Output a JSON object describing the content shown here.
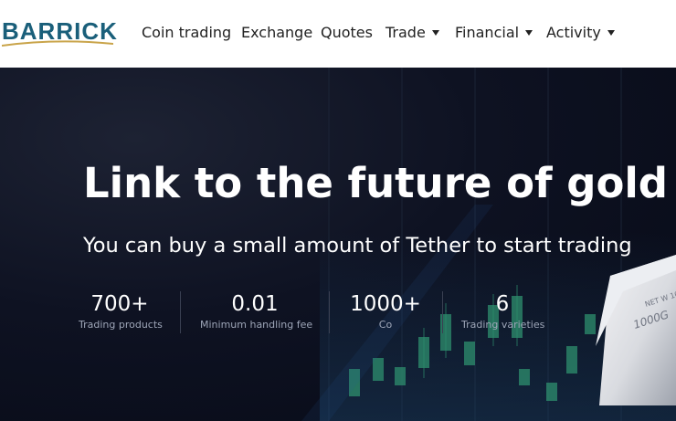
{
  "header": {
    "logo_text": "BARRICK",
    "nav": [
      {
        "label": "Coin trading"
      },
      {
        "label": "Exchange"
      },
      {
        "label": "Quotes"
      },
      {
        "label": "Trade"
      },
      {
        "label": "Financial"
      },
      {
        "label": "Activity"
      }
    ]
  },
  "hero": {
    "headline": "Link to the future of gold",
    "subline": "You can buy a small amount of Tether to start trading",
    "stats": [
      {
        "value": "700+",
        "label": "Trading products"
      },
      {
        "value": "0.01",
        "label": "Minimum handling fee"
      },
      {
        "value": "1000+",
        "label": "Co"
      },
      {
        "value": "6",
        "label": "Trading varieties"
      }
    ],
    "bar_engraving": "NET W 1000G"
  },
  "colors": {
    "brand": "#1a5f7a",
    "hero_bg": "#0b1020",
    "candle_green": "#2e8f6e"
  }
}
